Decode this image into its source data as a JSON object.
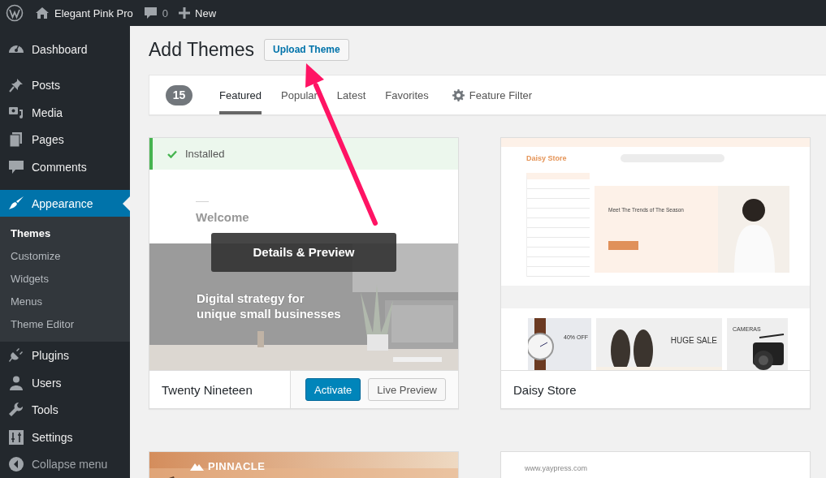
{
  "admin_bar": {
    "site_name": "Elegant Pink Pro",
    "comments_count": "0",
    "new_label": "New"
  },
  "sidebar": {
    "items": [
      {
        "label": "Dashboard",
        "selected": false
      },
      {
        "label": "Posts",
        "selected": false
      },
      {
        "label": "Media",
        "selected": false
      },
      {
        "label": "Pages",
        "selected": false
      },
      {
        "label": "Comments",
        "selected": false
      },
      {
        "label": "Appearance",
        "selected": true,
        "children": [
          {
            "label": "Themes",
            "selected": true
          },
          {
            "label": "Customize",
            "selected": false
          },
          {
            "label": "Widgets",
            "selected": false
          },
          {
            "label": "Menus",
            "selected": false
          },
          {
            "label": "Theme Editor",
            "selected": false
          }
        ]
      },
      {
        "label": "Plugins",
        "selected": false
      },
      {
        "label": "Users",
        "selected": false
      },
      {
        "label": "Tools",
        "selected": false
      },
      {
        "label": "Settings",
        "selected": false
      },
      {
        "label": "Collapse menu",
        "selected": false
      }
    ]
  },
  "page": {
    "title": "Add Themes",
    "upload_button": "Upload Theme"
  },
  "filter_bar": {
    "count": "15",
    "tabs": [
      {
        "label": "Featured",
        "selected": true
      },
      {
        "label": "Popular",
        "selected": false
      },
      {
        "label": "Latest",
        "selected": false
      },
      {
        "label": "Favorites",
        "selected": false
      }
    ],
    "feature_filter": "Feature Filter"
  },
  "themes": [
    {
      "name": "Twenty Nineteen",
      "installed": true,
      "installed_label": "Installed",
      "hovered": true,
      "overlay_label": "Details & Preview",
      "actions": [
        "Activate",
        "Live Preview"
      ],
      "preview": {
        "kind": "blog",
        "heading": "Welcome",
        "tagline": "Digital strategy for unique small businesses"
      }
    },
    {
      "name": "Daisy Store",
      "installed": false,
      "hovered": false,
      "preview": {
        "kind": "shop",
        "logo": "Daisy Store",
        "hero": "Meet The Trends of The Season",
        "banners": [
          "40% OFF",
          "HUGE SALE",
          "CAMERAS"
        ]
      }
    },
    {
      "installed": false,
      "hovered": false,
      "preview": {
        "kind": "banner",
        "logo": "PINNACLE"
      }
    },
    {
      "installed": false,
      "hovered": false,
      "preview": {
        "kind": "plain",
        "logo": "www.yaypress.com"
      }
    }
  ]
}
